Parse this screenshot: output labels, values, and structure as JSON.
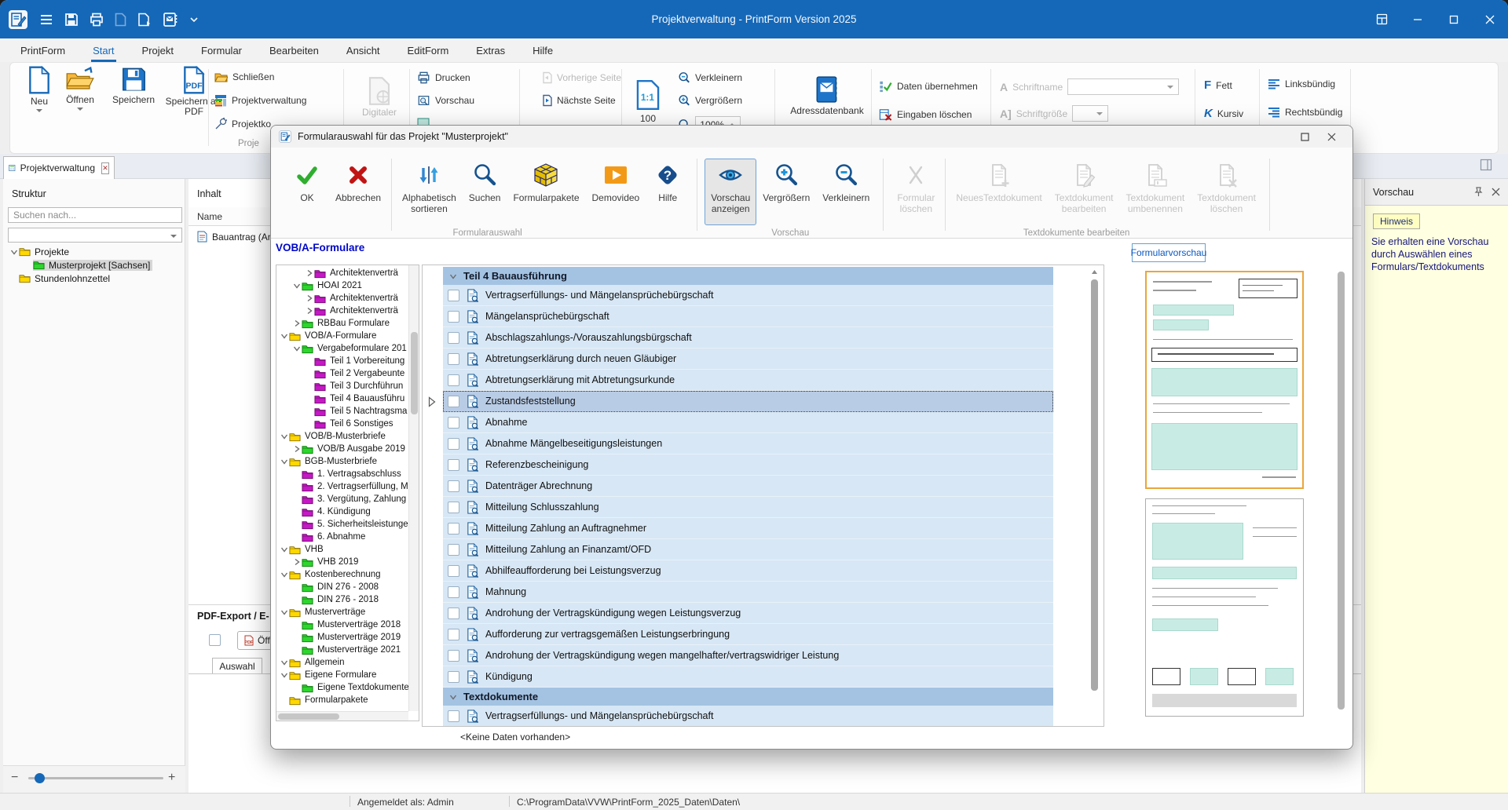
{
  "window": {
    "title": "Projektverwaltung - PrintForm Version 2025",
    "titlebar_icons": [
      "app-icon",
      "list-icon",
      "save-icon",
      "print-icon",
      "new-document-icon",
      "document-arrow-icon",
      "address-book-icon",
      "chevron-down-icon"
    ],
    "window_controls": [
      "layout-icon",
      "minimize-icon",
      "maximize-icon",
      "close-icon"
    ]
  },
  "menu": {
    "active": "Start",
    "items": [
      "PrintForm",
      "Start",
      "Projekt",
      "Formular",
      "Bearbeiten",
      "Ansicht",
      "EditForm",
      "Extras",
      "Hilfe"
    ]
  },
  "ribbon": {
    "neu": "Neu",
    "oeffnen": "Öffnen",
    "speichern": "Speichern",
    "speichern_als_pdf": "Speichern als PDF",
    "schliessen": "Schließen",
    "projektverwaltung": "Projektverwaltung",
    "projektko": "Projektko",
    "gruppe_proje": "Proje",
    "digitaler": "Digitaler",
    "drucken": "Drucken",
    "vorschau": "Vorschau",
    "vorherige_seite": "Vorherige Seite",
    "naechste_seite": "Nächste Seite",
    "zoom_100": "100",
    "verkleinern": "Verkleinern",
    "vergroessern": "Vergrößern",
    "zoom_wert": "100%",
    "adressdatenbank": "Adressdatenbank",
    "daten_uebernehmen": "Daten übernehmen",
    "eingaben_loeschen": "Eingaben löschen",
    "schriftname": "Schriftname",
    "schriftgroesse": "Schriftgröße",
    "fett": "Fett",
    "kursiv": "Kursiv",
    "linksbuendig": "Linksbündig",
    "rechtsbuendig": "Rechtsbündig"
  },
  "tabstrip": {
    "active_tab": "Projektverwaltung"
  },
  "struktur": {
    "title": "Struktur",
    "search_placeholder": "Suchen nach...",
    "tree": [
      {
        "level": 0,
        "chev": "v",
        "color": "yellow",
        "label": "Projekte"
      },
      {
        "level": 1,
        "color": "green",
        "label": "Musterprojekt [Sachsen]",
        "selected": true
      },
      {
        "level": 0,
        "color": "yellow",
        "label": "Stundenlohnzettel"
      }
    ]
  },
  "inhalt": {
    "title": "Inhalt",
    "column": "Name",
    "item": "Bauantrag (Anla"
  },
  "pdf_export": {
    "title": "PDF-Export / E-",
    "open_button": "Öff",
    "tab": "Auswahl"
  },
  "statusbar": {
    "user": "Angemeldet als: Admin",
    "path": "C:\\ProgramData\\VVW\\PrintForm_2025_Daten\\Daten\\"
  },
  "vorschau_panel": {
    "title": "Vorschau",
    "icons": [
      "pin-icon",
      "close-icon"
    ],
    "hinweis_tab": "Hinweis",
    "hinweis_text": "Sie erhalten eine Vorschau durch Auswählen eines Formulars/Textdokuments"
  },
  "dialog": {
    "title": "Formularauswahl für das Projekt \"Musterprojekt\"",
    "heading": "VOB/A-Formulare",
    "preview_tab": "Formularvorschau",
    "empty_text": "<Keine Daten vorhanden>",
    "toolbar": {
      "sections": [
        {
          "label": "Formularauswahl",
          "clusters": [
            [
              {
                "id": "ok",
                "icon": "check",
                "label": "OK"
              },
              {
                "id": "abbrechen",
                "icon": "cancel",
                "label": "Abbrechen"
              }
            ],
            [
              {
                "id": "alphabetisch-sortieren",
                "icon": "sort",
                "label": "Alphabetisch\nsortieren"
              },
              {
                "id": "suchen",
                "icon": "search",
                "label": "Suchen"
              },
              {
                "id": "formularpakete",
                "icon": "package",
                "label": "Formularpakete"
              },
              {
                "id": "demovideo",
                "icon": "play",
                "label": "Demovideo"
              },
              {
                "id": "hilfe",
                "icon": "help",
                "label": "Hilfe"
              }
            ]
          ]
        },
        {
          "label": "Vorschau",
          "clusters": [
            [
              {
                "id": "vorschau-anzeigen",
                "icon": "eye",
                "label": "Vorschau\nanzeigen",
                "selected": true
              },
              {
                "id": "vergroessern",
                "icon": "zoom-in",
                "label": "Vergrößern"
              },
              {
                "id": "verkleinern",
                "icon": "zoom-out",
                "label": "Verkleinern"
              }
            ]
          ]
        },
        {
          "label": "Textdokumente bearbeiten",
          "clusters": [
            [
              {
                "id": "formular-loeschen",
                "icon": "delete",
                "label": "Formular\nlöschen",
                "disabled": true
              }
            ],
            [
              {
                "id": "neues-textdokument",
                "icon": "doc-plus",
                "label": "NeuesTextdokument",
                "disabled": true
              },
              {
                "id": "textdokument-bearbeiten",
                "icon": "doc-edit",
                "label": "Textdokument\nbearbeiten",
                "disabled": true
              },
              {
                "id": "textdokument-umbenennen",
                "icon": "doc-rename",
                "label": "Textdokument\numbenennen",
                "disabled": true
              },
              {
                "id": "textdokument-loeschen",
                "icon": "doc-delete",
                "label": "Textdokument\nlöschen",
                "disabled": true
              }
            ]
          ]
        }
      ]
    },
    "tree": [
      {
        "level": 2,
        "chev": ">",
        "color": "purple",
        "label": "Architektenverträ"
      },
      {
        "level": 1,
        "chev": "v",
        "color": "green",
        "label": "HOAI 2021"
      },
      {
        "level": 2,
        "chev": ">",
        "color": "purple",
        "label": "Architektenverträ"
      },
      {
        "level": 2,
        "chev": ">",
        "color": "purple",
        "label": "Architektenverträ"
      },
      {
        "level": 1,
        "chev": ">",
        "color": "green",
        "label": "RBBau Formulare"
      },
      {
        "level": 0,
        "chev": "v",
        "color": "yellow",
        "label": "VOB/A-Formulare"
      },
      {
        "level": 1,
        "chev": "v",
        "color": "green",
        "label": "Vergabeformulare 201"
      },
      {
        "level": 2,
        "color": "purple",
        "label": "Teil 1 Vorbereitung"
      },
      {
        "level": 2,
        "color": "purple",
        "label": "Teil 2 Vergabeunte"
      },
      {
        "level": 2,
        "color": "purple",
        "label": "Teil 3 Durchführun"
      },
      {
        "level": 2,
        "color": "purple",
        "label": "Teil 4 Bauausführu"
      },
      {
        "level": 2,
        "color": "purple",
        "label": "Teil 5 Nachtragsma"
      },
      {
        "level": 2,
        "color": "purple",
        "label": "Teil 6 Sonstiges"
      },
      {
        "level": 0,
        "chev": "v",
        "color": "yellow",
        "label": "VOB/B-Musterbriefe"
      },
      {
        "level": 1,
        "chev": ">",
        "color": "green",
        "label": "VOB/B Ausgabe 2019"
      },
      {
        "level": 0,
        "chev": "v",
        "color": "yellow",
        "label": "BGB-Musterbriefe"
      },
      {
        "level": 1,
        "color": "purple",
        "label": "1. Vertragsabschluss"
      },
      {
        "level": 1,
        "color": "purple",
        "label": "2. Vertragserfüllung, M"
      },
      {
        "level": 1,
        "color": "purple",
        "label": "3. Vergütung, Zahlung"
      },
      {
        "level": 1,
        "color": "purple",
        "label": "4. Kündigung"
      },
      {
        "level": 1,
        "color": "purple",
        "label": "5. Sicherheitsleistunge"
      },
      {
        "level": 1,
        "color": "purple",
        "label": "6. Abnahme"
      },
      {
        "level": 0,
        "chev": "v",
        "color": "yellow",
        "label": "VHB"
      },
      {
        "level": 1,
        "chev": ">",
        "color": "green",
        "label": "VHB 2019"
      },
      {
        "level": 0,
        "chev": "v",
        "color": "yellow",
        "label": "Kostenberechnung"
      },
      {
        "level": 1,
        "color": "green",
        "label": "DIN 276 - 2008"
      },
      {
        "level": 1,
        "color": "green",
        "label": "DIN 276 - 2018"
      },
      {
        "level": 0,
        "chev": "v",
        "color": "yellow",
        "label": "Musterverträge"
      },
      {
        "level": 1,
        "color": "green",
        "label": "Musterverträge 2018"
      },
      {
        "level": 1,
        "color": "green",
        "label": "Musterverträge 2019"
      },
      {
        "level": 1,
        "color": "green",
        "label": "Musterverträge 2021"
      },
      {
        "level": 0,
        "chev": "v",
        "color": "yellow",
        "label": "Allgemein"
      },
      {
        "level": 0,
        "chev": "v",
        "color": "yellow",
        "label": "Eigene Formulare"
      },
      {
        "level": 1,
        "color": "green",
        "label": "Eigene Textdokumente"
      },
      {
        "level": 0,
        "color": "yellow",
        "label": "Formularpakete"
      }
    ],
    "list_sections": [
      {
        "title": "Teil 4 Bauausführung",
        "items": [
          {
            "label": "Vertragserfüllungs- und Mängelansprüchebürgschaft",
            "checked": false
          },
          {
            "label": "Mängelansprüchebürgschaft",
            "checked": false
          },
          {
            "label": "Abschlagszahlungs-/Vorauszahlungsbürgschaft",
            "checked": false
          },
          {
            "label": "Abtretungserklärung durch neuen Gläubiger",
            "checked": false
          },
          {
            "label": "Abtretungserklärung mit Abtretungsurkunde",
            "checked": false
          },
          {
            "label": "Zustandsfeststellung",
            "checked": false,
            "selected": true
          },
          {
            "label": "Abnahme",
            "checked": false
          },
          {
            "label": "Abnahme Mängelbeseitigungsleistungen",
            "checked": false
          },
          {
            "label": "Referenzbescheinigung",
            "checked": false
          },
          {
            "label": "Datenträger Abrechnung",
            "checked": false
          },
          {
            "label": "Mitteilung Schlusszahlung",
            "checked": false
          },
          {
            "label": "Mitteilung Zahlung an Auftragnehmer",
            "checked": false
          },
          {
            "label": "Mitteilung Zahlung an Finanzamt/OFD",
            "checked": false
          },
          {
            "label": "Abhilfeaufforderung bei Leistungsverzug",
            "checked": false
          },
          {
            "label": "Mahnung",
            "checked": false
          },
          {
            "label": "Androhung der Vertragskündigung wegen Leistungsverzug",
            "checked": false
          },
          {
            "label": "Aufforderung zur vertragsgemäßen Leistungserbringung",
            "checked": false
          },
          {
            "label": "Androhung der Vertragskündigung wegen mangelhafter/vertragswidriger Leistung",
            "checked": false
          },
          {
            "label": "Kündigung",
            "checked": false
          }
        ]
      },
      {
        "title": "Textdokumente",
        "items": [
          {
            "label": "Vertragserfüllungs- und Mängelansprüchebürgschaft",
            "checked": false
          }
        ]
      }
    ]
  }
}
